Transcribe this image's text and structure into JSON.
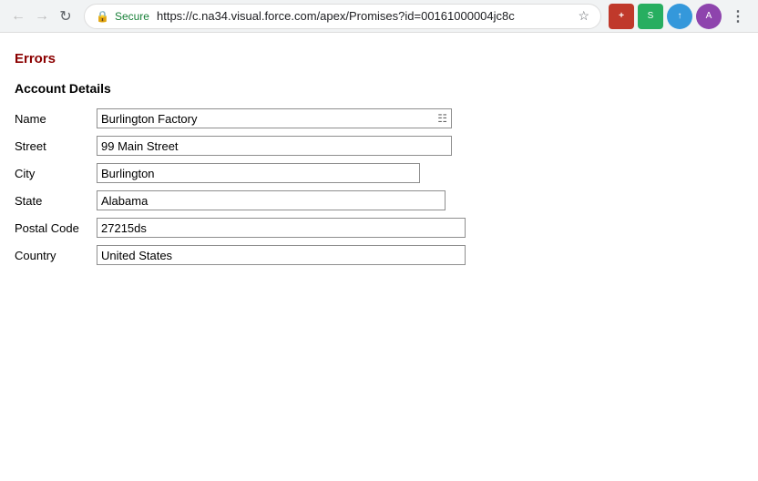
{
  "browser": {
    "url": "https://c.na34.visual.force.com/apex/Promises?id=00161000004jc8c",
    "secure_label": "Secure"
  },
  "page": {
    "errors_title": "Errors",
    "section_title": "Account Details",
    "form": {
      "name_label": "Name",
      "name_value": "Burlington Factory",
      "street_label": "Street",
      "street_value": "99 Main Street",
      "city_label": "City",
      "city_value": "Burlington",
      "state_label": "State",
      "state_value": "Alabama",
      "postal_code_label": "Postal Code",
      "postal_code_value": "27215ds",
      "country_label": "Country",
      "country_value": "United States"
    }
  }
}
